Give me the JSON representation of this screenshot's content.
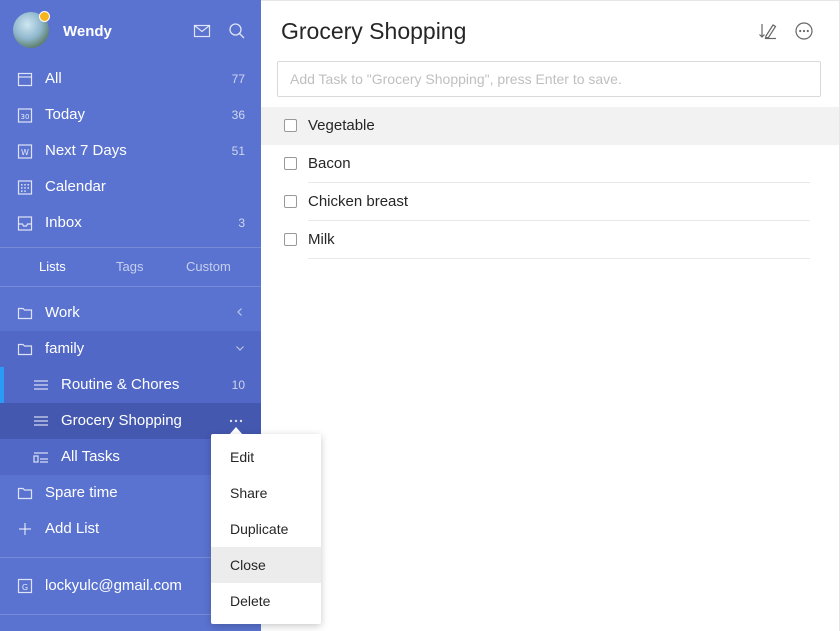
{
  "user": {
    "name": "Wendy",
    "avatar_icon": "avatar-photo-icon",
    "badge_icon": "premium-crown-icon"
  },
  "sidebar": {
    "smart_lists": [
      {
        "label": "All",
        "count": "77",
        "icon": "all-icon"
      },
      {
        "label": "Today",
        "count": "36",
        "icon": "calendar-30-icon"
      },
      {
        "label": "Next 7 Days",
        "count": "51",
        "icon": "calendar-w-icon"
      },
      {
        "label": "Calendar",
        "count": "",
        "icon": "calendar-grid-icon"
      },
      {
        "label": "Inbox",
        "count": "3",
        "icon": "inbox-icon"
      }
    ],
    "tabs": [
      "Lists",
      "Tags",
      "Custom"
    ],
    "active_tab": "Lists",
    "lists": [
      {
        "label": "Work",
        "count": "",
        "icon": "folder-icon"
      },
      {
        "label": "family",
        "count": "",
        "icon": "folder-icon"
      },
      {
        "label": "Routine & Chores",
        "count": "10",
        "icon": "list-icon"
      },
      {
        "label": "Grocery Shopping",
        "count": "",
        "icon": "list-icon"
      },
      {
        "label": "All Tasks",
        "count": "",
        "icon": "all-tasks-icon"
      },
      {
        "label": "Spare time",
        "count": "",
        "icon": "folder-icon"
      },
      {
        "label": "Add List",
        "count": "",
        "icon": "plus-icon"
      }
    ],
    "account": {
      "label": "lockyulc@gmail.com",
      "icon": "google-icon"
    }
  },
  "main": {
    "title": "Grocery Shopping",
    "add_task_placeholder": "Add Task to \"Grocery Shopping\", press Enter to save.",
    "add_task_value": "",
    "tasks": [
      {
        "title": "Vegetable",
        "checked": false
      },
      {
        "title": "Bacon",
        "checked": false
      },
      {
        "title": "Chicken breast",
        "checked": false
      },
      {
        "title": "Milk",
        "checked": false
      }
    ]
  },
  "context_menu": {
    "items": [
      "Edit",
      "Share",
      "Duplicate",
      "Close",
      "Delete"
    ],
    "highlighted": "Close"
  },
  "colors": {
    "sidebar_bg": "#5a73d0",
    "sidebar_active": "#4458b0",
    "indicator": "#2a9cf5",
    "text": "#262626"
  }
}
